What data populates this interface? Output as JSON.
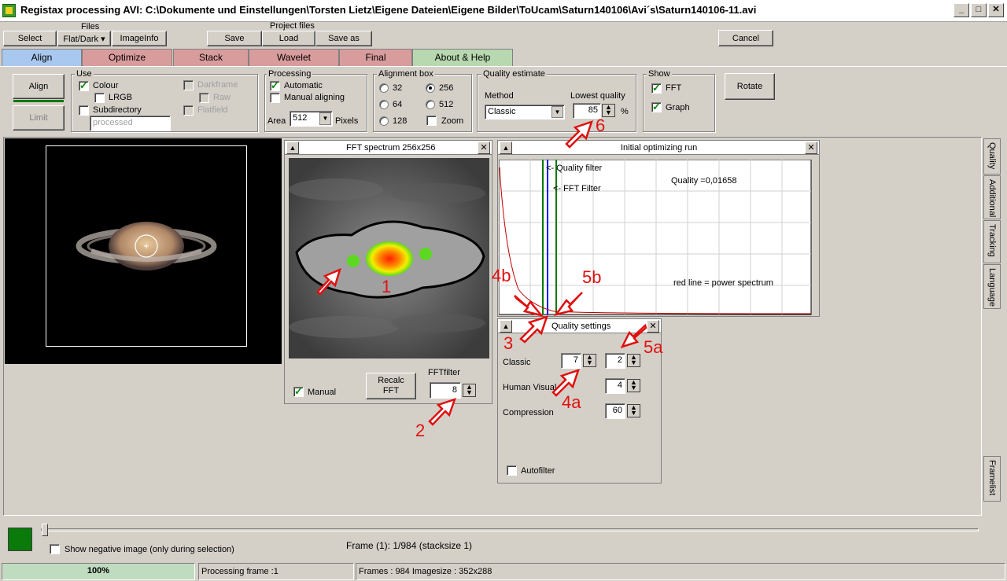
{
  "window": {
    "title": "Registax processing AVI: C:\\Dokumente und Einstellungen\\Torsten Lietz\\Eigene Dateien\\Eigene Bilder\\ToUcam\\Saturn140106\\Avi´s\\Saturn140106-11.avi",
    "minimize": "_",
    "maximize": "□",
    "close": "✕"
  },
  "toolbar": {
    "files_label": "Files",
    "select": "Select",
    "flatdark": "Flat/Dark ▾",
    "imageinfo": "ImageInfo",
    "project_files_label": "Project files",
    "save": "Save",
    "load": "Load",
    "save_as": "Save as",
    "cancel": "Cancel"
  },
  "tabs": [
    {
      "label": "Align",
      "color": "#a9c8ef"
    },
    {
      "label": "Optimize",
      "color": "#d99c9c"
    },
    {
      "label": "Stack",
      "color": "#d99c9c"
    },
    {
      "label": "Wavelet",
      "color": "#d99c9c"
    },
    {
      "label": "Final",
      "color": "#d99c9c"
    },
    {
      "label": "About & Help",
      "color": "#b8d8b0"
    }
  ],
  "align_panel": {
    "align_button": "Align",
    "limit_button": "Limit",
    "use": {
      "title": "Use",
      "colour": "Colour",
      "lrgb": "LRGB",
      "subdirectory": "Subdirectory",
      "processed_placeholder": "processed",
      "darkframe": "Darkframe",
      "raw": "Raw",
      "flatfield": "Flatfield"
    },
    "processing": {
      "title": "Processing",
      "automatic": "Automatic",
      "manual": "Manual aligning",
      "area_label": "Area",
      "area_value": "512",
      "pixels": "Pixels"
    },
    "alignment_box": {
      "title": "Alignment box",
      "options": [
        "32",
        "256",
        "64",
        "512",
        "128"
      ],
      "selected": "256",
      "zoom": "Zoom"
    },
    "quality": {
      "title": "Quality estimate",
      "method_label": "Method",
      "method_value": "Classic",
      "lowest_label": "Lowest quality",
      "lowest_value": "85",
      "percent": "%"
    },
    "show": {
      "title": "Show",
      "fft": "FFT",
      "graph": "Graph"
    },
    "rotate": "Rotate"
  },
  "fft_panel": {
    "title": "FFT spectrum 256x256",
    "manual": "Manual",
    "recalc": "Recalc\nFFT",
    "fftfilter_label": "FFTfilter",
    "fftfilter_value": "8"
  },
  "graph_panel": {
    "title": "Initial optimizing run",
    "quality_filter": "<- Quality filter",
    "fft_filter": "<- FFT Filter",
    "quality_text": "Quality =0,01658",
    "red_line": "red line = power spectrum"
  },
  "quality_settings": {
    "title": "Quality settings",
    "classic": "Classic",
    "classic_v1": "7",
    "classic_v2": "2",
    "human_visual": "Human Visual",
    "human_visual_v": "4",
    "compression": "Compression",
    "compression_v": "60",
    "autofilter": "Autofilter"
  },
  "annotations": [
    "1",
    "2",
    "3",
    "4a",
    "4b",
    "5a",
    "5b",
    "6"
  ],
  "side_tabs": [
    "Quality",
    "Additional",
    "Tracking",
    "Language",
    "Framelist"
  ],
  "bottom": {
    "show_negative": "Show negative image (only during selection)",
    "frame_info": "Frame (1): 1/984 (stacksize 1)",
    "progress_pct": 100,
    "progress_text": "100%",
    "status_processing": "Processing frame :1",
    "status_frames": "Frames : 984 Imagesize : 352x288"
  },
  "colors": {
    "accent_green": "#0a7a0a",
    "annotation_red": "#e01010"
  }
}
